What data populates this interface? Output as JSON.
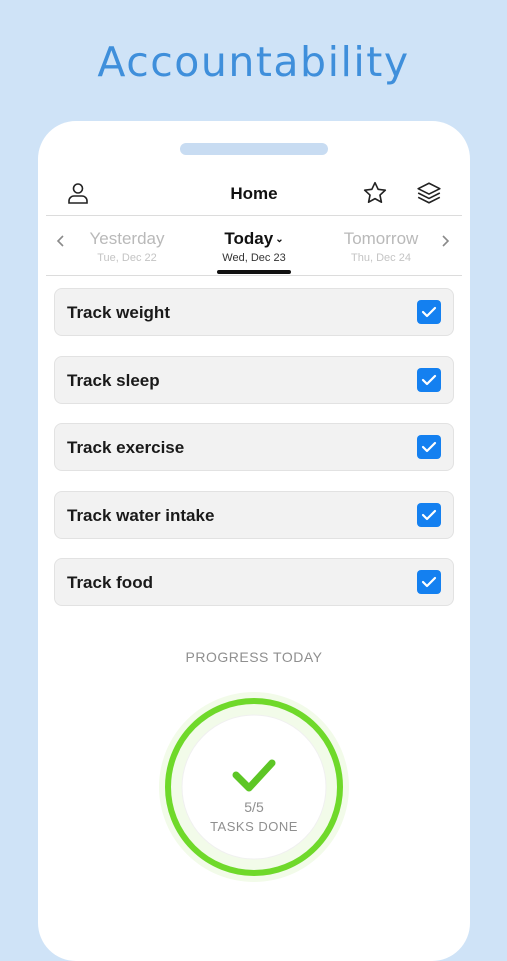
{
  "headline": "Accountability",
  "header": {
    "title": "Home"
  },
  "icons": {
    "profile": "person-icon",
    "favorite": "star-icon",
    "layers": "layers-icon",
    "prev": "chevron-left-icon",
    "next": "chevron-right-icon",
    "check": "checkmark-icon"
  },
  "days": {
    "yesterday": {
      "name": "Yesterday",
      "date": "Tue, Dec 22"
    },
    "today": {
      "name": "Today",
      "date": "Wed, Dec 23"
    },
    "tomorrow": {
      "name": "Tomorrow",
      "date": "Thu, Dec 24"
    }
  },
  "tasks": [
    {
      "label": "Track weight",
      "checked": true
    },
    {
      "label": "Track sleep",
      "checked": true
    },
    {
      "label": "Track exercise",
      "checked": true
    },
    {
      "label": "Track water intake",
      "checked": true
    },
    {
      "label": "Track food",
      "checked": true
    }
  ],
  "progress": {
    "label": "PROGRESS TODAY",
    "count": "5/5",
    "caption": "TASKS DONE",
    "fraction": 1.0
  },
  "colors": {
    "background": "#cfe3f7",
    "headline": "#3f8fdb",
    "checkbox": "#1480f0",
    "progress": "#6fd92a"
  }
}
